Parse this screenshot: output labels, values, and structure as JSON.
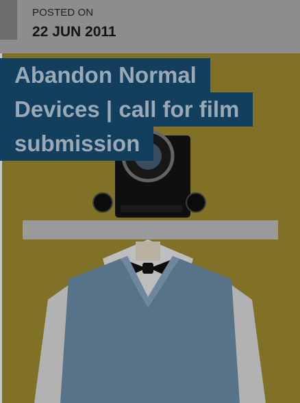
{
  "meta": {
    "posted_label": "POSTED ON",
    "posted_date": "22 JUN 2011"
  },
  "post": {
    "title_lines": [
      "Abandon Normal",
      "Devices | call for film",
      "submission"
    ]
  },
  "image": {
    "subject_icon": "person-with-camera-head-icon",
    "background_color": "#8b7b2a",
    "sweater_color": "#5f7d96",
    "accent_color": "#123f5e"
  },
  "colors": {
    "overlay": "#000000",
    "title_background": "#123f5e",
    "title_text": "#9aa9b3",
    "meta_background": "#8d8d8d"
  }
}
